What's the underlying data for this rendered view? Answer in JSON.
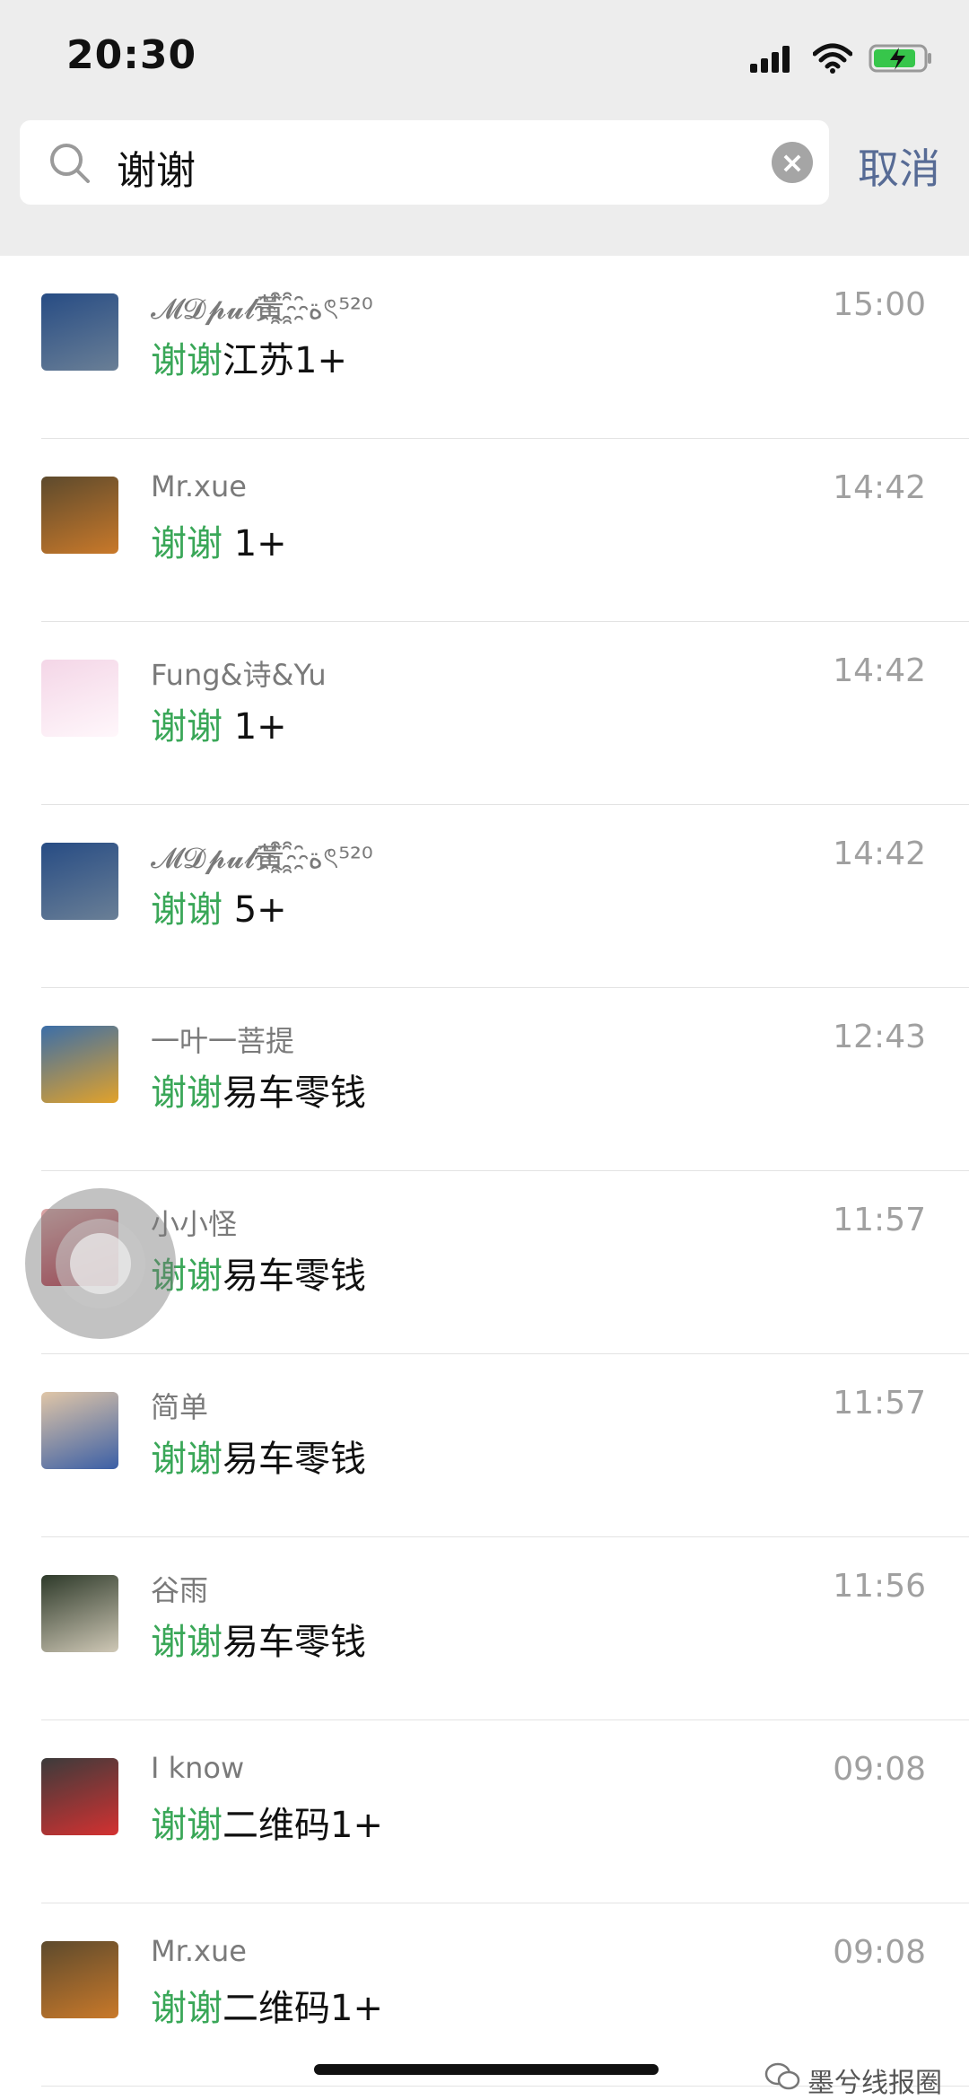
{
  "status": {
    "time": "20:30"
  },
  "search": {
    "query": "谢谢",
    "cancel_label": "取消"
  },
  "results": [
    {
      "name": "𝓜𝓓𝓹𝓾𝓵黃ة҈҈ৎ⁵²⁰",
      "highlight": "谢谢",
      "rest": "江苏1+",
      "time": "15:00",
      "avatar_colors": [
        "#274c84",
        "#6a7f96"
      ]
    },
    {
      "name": "Mr.xue",
      "highlight": "谢谢",
      "rest": " 1+",
      "time": "14:42",
      "avatar_colors": [
        "#5d4a2d",
        "#c9792a"
      ]
    },
    {
      "name": "Fung&诗&Yu",
      "highlight": "谢谢",
      "rest": " 1+",
      "time": "14:42",
      "avatar_colors": [
        "#f4d6e7",
        "#fff7fb"
      ]
    },
    {
      "name": "𝓜𝓓𝓹𝓾𝓵黃ة҈҈ৎ⁵²⁰",
      "highlight": "谢谢",
      "rest": " 5+",
      "time": "14:42",
      "avatar_colors": [
        "#274c84",
        "#6a7f96"
      ]
    },
    {
      "name": "一叶一菩提",
      "highlight": "谢谢",
      "rest": "易车零钱",
      "time": "12:43",
      "avatar_colors": [
        "#3b6ea8",
        "#e2a22a"
      ]
    },
    {
      "name": "小小怪",
      "highlight": "谢谢",
      "rest": "易车零钱",
      "time": "11:57",
      "avatar_colors": [
        "#d9a7a7",
        "#b7263c"
      ]
    },
    {
      "name": "简单",
      "highlight": "谢谢",
      "rest": "易车零钱",
      "time": "11:57",
      "avatar_colors": [
        "#e0c6a7",
        "#3b5fa6"
      ]
    },
    {
      "name": "谷雨",
      "highlight": "谢谢",
      "rest": "易车零钱",
      "time": "11:56",
      "avatar_colors": [
        "#2e3a2a",
        "#cfc8b6"
      ]
    },
    {
      "name": "I know",
      "highlight": "谢谢",
      "rest": "二维码1+",
      "time": "09:08",
      "avatar_colors": [
        "#3b3b3b",
        "#d43131"
      ]
    },
    {
      "name": "Mr.xue",
      "highlight": "谢谢",
      "rest": "二维码1+",
      "time": "09:08",
      "avatar_colors": [
        "#5d4a2d",
        "#c9792a"
      ]
    }
  ],
  "watermark": {
    "text": "墨兮线报圈"
  },
  "icons": {
    "search": "magnifier-icon",
    "clear": "clear-x-icon",
    "signal": "signal-icon",
    "wifi": "wifi-icon",
    "battery": "battery-charging-icon",
    "assistive": "assistive-touch-icon",
    "wechat": "wechat-logo-icon"
  }
}
